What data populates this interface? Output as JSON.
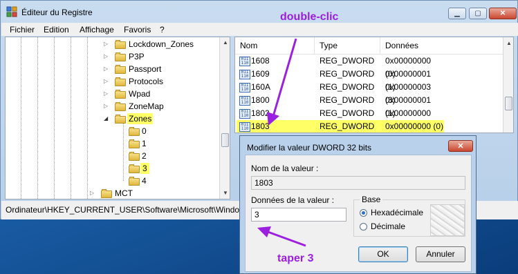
{
  "window": {
    "title": "Éditeur du Registre",
    "controls": {
      "minimize": "▁",
      "maximize": "▢",
      "close": "✕"
    }
  },
  "menu": [
    "Fichier",
    "Edition",
    "Affichage",
    "Favoris",
    "?"
  ],
  "tree": {
    "items": [
      {
        "label": "Lockdown_Zones"
      },
      {
        "label": "P3P"
      },
      {
        "label": "Passport"
      },
      {
        "label": "Protocols"
      },
      {
        "label": "Wpad"
      },
      {
        "label": "ZoneMap"
      },
      {
        "label": "Zones"
      },
      {
        "label": "0"
      },
      {
        "label": "1"
      },
      {
        "label": "2"
      },
      {
        "label": "3"
      },
      {
        "label": "4"
      },
      {
        "label": "MCT"
      }
    ]
  },
  "list": {
    "headers": {
      "name": "Nom",
      "type": "Type",
      "data": "Données"
    },
    "rows": [
      {
        "name": "1608",
        "type": "REG_DWORD",
        "data": "0x00000000 (0)"
      },
      {
        "name": "1609",
        "type": "REG_DWORD",
        "data": "0x00000001 (1)"
      },
      {
        "name": "160A",
        "type": "REG_DWORD",
        "data": "0x00000003 (3)"
      },
      {
        "name": "1800",
        "type": "REG_DWORD",
        "data": "0x00000001 (1)"
      },
      {
        "name": "1802",
        "type": "REG_DWORD",
        "data": "0x00000000 (0)"
      },
      {
        "name": "1803",
        "type": "REG_DWORD",
        "data": "0x00000000 (0)"
      }
    ],
    "icon_text": "011\n110"
  },
  "status": {
    "path": "Ordinateur\\HKEY_CURRENT_USER\\Software\\Microsoft\\Window"
  },
  "dialog": {
    "title": "Modifier la valeur DWORD 32 bits",
    "close": "✕",
    "name_label": "Nom de la valeur :",
    "name_value": "1803",
    "data_label": "Données de la valeur :",
    "data_value": "3",
    "base_label": "Base",
    "hex_label": "Hexadécimale",
    "dec_label": "Décimale",
    "ok": "OK",
    "cancel": "Annuler"
  },
  "annotations": {
    "double_click": "double-clic",
    "type_3": "taper 3"
  },
  "colors": {
    "highlight": "#ffff66",
    "annotation": "#9b1fe0"
  }
}
